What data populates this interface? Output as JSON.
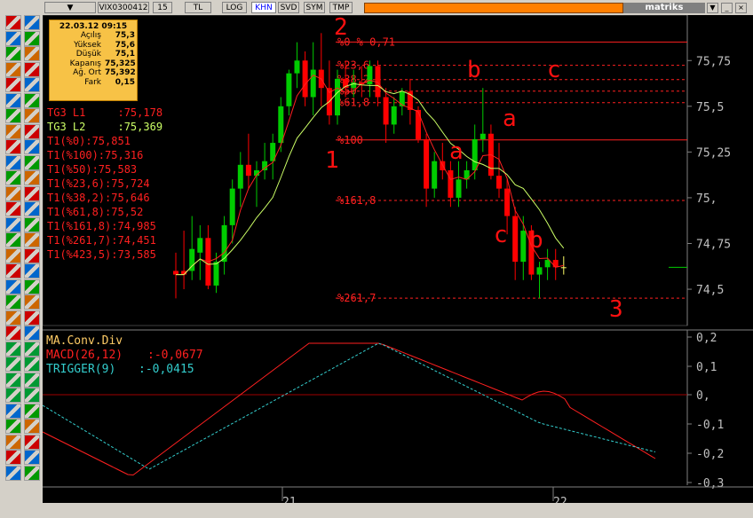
{
  "toolbar": {
    "symbol": "VIX0300412",
    "period": "15",
    "currency": "TL",
    "buttons": [
      "LOG",
      "KHN",
      "SVD",
      "SYM",
      "TMP"
    ],
    "brand": "matriks"
  },
  "info_box": {
    "datetime": "22.03.12 09:15",
    "rows": [
      {
        "label": "Açılış",
        "value": "75,3"
      },
      {
        "label": "Yüksek",
        "value": "75,6"
      },
      {
        "label": "Düşük",
        "value": "75,1"
      },
      {
        "label": "Kapanış",
        "value": "75,325"
      },
      {
        "label": "Ağ. Ort",
        "value": "75,392"
      },
      {
        "label": "Fark",
        "value": "0,15"
      }
    ]
  },
  "levels": [
    {
      "text": "TG3 L1     :75,178",
      "color": "#ff2020"
    },
    {
      "text": "TG3 L2     :75,369",
      "color": "#ccff66"
    },
    {
      "text": "T1(%0):75,851",
      "color": "#ff2020"
    },
    {
      "text": "T1(%100):75,316",
      "color": "#ff2020"
    },
    {
      "text": "T1(%50):75,583",
      "color": "#ff2020"
    },
    {
      "text": "T1(%23,6):75,724",
      "color": "#ff2020"
    },
    {
      "text": "T1(%38,2):75,646",
      "color": "#ff2020"
    },
    {
      "text": "T1(%61,8):75,52",
      "color": "#ff2020"
    },
    {
      "text": "T1(%161,8):74,985",
      "color": "#ff2020"
    },
    {
      "text": "T1(%261,7):74,451",
      "color": "#ff2020"
    },
    {
      "text": "T1(%423,5):73,585",
      "color": "#ff2020"
    }
  ],
  "fib_labels": [
    "%0 % 0,71",
    "%23,6",
    "%38,2",
    "%50",
    "%61,8",
    "%100",
    "%161,8",
    "%261,7"
  ],
  "annotations": [
    "2",
    "1",
    "b",
    "c",
    "a",
    "a",
    "c",
    "b",
    "3"
  ],
  "price_axis": [
    "75,75",
    "75,5",
    "75,25",
    "75,",
    "74,75",
    "74,5"
  ],
  "macd_panel": {
    "title": "MA.Conv.Div",
    "macd_label": "MACD(26,12)",
    "macd_value": ":-0,0677",
    "trigger_label": "TRIGGER(9)",
    "trigger_value": ":-0,0415",
    "axis": [
      "0,2",
      "0,1",
      "0,",
      "-0,1",
      "-0,2",
      "-0,3"
    ]
  },
  "time_axis": [
    "21",
    "22"
  ],
  "colors": {
    "up": "#00cc00",
    "down": "#ff0000",
    "neutral": "#ffff66",
    "ma_fast": "#ff2020",
    "ma_slow": "#ccff66",
    "fib": "#ff2020",
    "macd": "#ff2020",
    "trigger": "#33cccc"
  },
  "chart_data": {
    "type": "candlestick",
    "y_range": [
      74.35,
      75.95
    ],
    "candles": [
      {
        "o": 74.6,
        "h": 74.7,
        "l": 74.45,
        "c": 74.58
      },
      {
        "o": 74.6,
        "h": 74.82,
        "l": 74.5,
        "c": 74.58
      },
      {
        "o": 74.6,
        "h": 74.9,
        "l": 74.55,
        "c": 74.72
      },
      {
        "o": 74.7,
        "h": 74.85,
        "l": 74.55,
        "c": 74.78
      },
      {
        "o": 74.78,
        "h": 74.85,
        "l": 74.5,
        "c": 74.52
      },
      {
        "o": 74.52,
        "h": 74.7,
        "l": 74.48,
        "c": 74.65
      },
      {
        "o": 74.65,
        "h": 74.9,
        "l": 74.58,
        "c": 74.85
      },
      {
        "o": 74.85,
        "h": 75.1,
        "l": 74.75,
        "c": 75.05
      },
      {
        "o": 75.05,
        "h": 75.25,
        "l": 74.95,
        "c": 75.18
      },
      {
        "o": 75.18,
        "h": 75.35,
        "l": 75.05,
        "c": 75.12
      },
      {
        "o": 75.12,
        "h": 75.2,
        "l": 74.95,
        "c": 75.15
      },
      {
        "o": 75.15,
        "h": 75.3,
        "l": 75.1,
        "c": 75.2
      },
      {
        "o": 75.2,
        "h": 75.35,
        "l": 75.1,
        "c": 75.3
      },
      {
        "o": 75.3,
        "h": 75.55,
        "l": 75.25,
        "c": 75.5
      },
      {
        "o": 75.5,
        "h": 75.7,
        "l": 75.45,
        "c": 75.68
      },
      {
        "o": 75.68,
        "h": 75.85,
        "l": 75.6,
        "c": 75.75
      },
      {
        "o": 75.75,
        "h": 75.8,
        "l": 75.5,
        "c": 75.55
      },
      {
        "o": 75.55,
        "h": 75.85,
        "l": 75.45,
        "c": 75.7
      },
      {
        "o": 75.7,
        "h": 75.9,
        "l": 75.5,
        "c": 75.6
      },
      {
        "o": 75.6,
        "h": 75.75,
        "l": 75.4,
        "c": 75.45
      },
      {
        "o": 75.45,
        "h": 75.7,
        "l": 75.4,
        "c": 75.65
      },
      {
        "o": 75.65,
        "h": 75.75,
        "l": 75.55,
        "c": 75.6
      },
      {
        "o": 75.6,
        "h": 75.7,
        "l": 75.55,
        "c": 75.63
      },
      {
        "o": 75.63,
        "h": 75.72,
        "l": 75.55,
        "c": 75.62
      },
      {
        "o": 75.62,
        "h": 75.75,
        "l": 75.55,
        "c": 75.72
      },
      {
        "o": 75.72,
        "h": 75.75,
        "l": 75.5,
        "c": 75.55
      },
      {
        "o": 75.55,
        "h": 75.6,
        "l": 75.3,
        "c": 75.4
      },
      {
        "o": 75.4,
        "h": 75.55,
        "l": 75.35,
        "c": 75.5
      },
      {
        "o": 75.5,
        "h": 75.6,
        "l": 75.45,
        "c": 75.58
      },
      {
        "o": 75.58,
        "h": 75.65,
        "l": 75.4,
        "c": 75.48
      },
      {
        "o": 75.48,
        "h": 75.5,
        "l": 75.3,
        "c": 75.32
      },
      {
        "o": 75.32,
        "h": 75.35,
        "l": 74.95,
        "c": 75.05
      },
      {
        "o": 75.05,
        "h": 75.25,
        "l": 75.0,
        "c": 75.2
      },
      {
        "o": 75.2,
        "h": 75.3,
        "l": 75.1,
        "c": 75.15
      },
      {
        "o": 75.15,
        "h": 75.2,
        "l": 74.95,
        "c": 75.0
      },
      {
        "o": 75.0,
        "h": 75.2,
        "l": 74.95,
        "c": 75.1
      },
      {
        "o": 75.1,
        "h": 75.2,
        "l": 75.05,
        "c": 75.15
      },
      {
        "o": 75.15,
        "h": 75.4,
        "l": 75.1,
        "c": 75.32
      },
      {
        "o": 75.32,
        "h": 75.6,
        "l": 75.25,
        "c": 75.35
      },
      {
        "o": 75.35,
        "h": 75.4,
        "l": 75.1,
        "c": 75.12
      },
      {
        "o": 75.12,
        "h": 75.3,
        "l": 75.0,
        "c": 75.05
      },
      {
        "o": 75.05,
        "h": 75.1,
        "l": 74.8,
        "c": 74.9
      },
      {
        "o": 74.9,
        "h": 74.95,
        "l": 74.55,
        "c": 74.65
      },
      {
        "o": 74.65,
        "h": 74.9,
        "l": 74.55,
        "c": 74.82
      },
      {
        "o": 74.82,
        "h": 74.85,
        "l": 74.55,
        "c": 74.58
      },
      {
        "o": 74.58,
        "h": 74.65,
        "l": 74.45,
        "c": 74.62
      },
      {
        "o": 74.62,
        "h": 74.72,
        "l": 74.55,
        "c": 74.66
      },
      {
        "o": 74.66,
        "h": 74.72,
        "l": 74.55,
        "c": 74.62
      },
      {
        "o": 74.62,
        "h": 74.68,
        "l": 74.58,
        "c": 74.62
      }
    ]
  }
}
